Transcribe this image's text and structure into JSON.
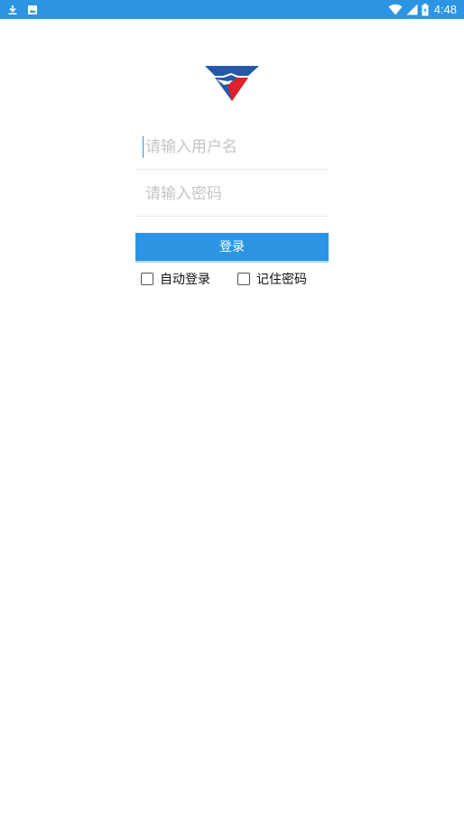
{
  "status_bar": {
    "time": "4:48",
    "background": "#2b95e3",
    "left_icons": [
      "download-icon",
      "image-icon"
    ],
    "right_icons": [
      "wifi-icon",
      "signal-icon",
      "battery-icon"
    ]
  },
  "logo": {
    "name": "brand-logo",
    "colors": {
      "blue": "#2658a8",
      "red": "#e0202a",
      "white": "#ffffff"
    }
  },
  "form": {
    "username_placeholder": "请输入用户名",
    "password_placeholder": "请输入密码",
    "login_label": "登录",
    "auto_login_label": "自动登录",
    "remember_password_label": "记住密码",
    "auto_login_checked": false,
    "remember_password_checked": false,
    "accent": "#2b95e3"
  }
}
